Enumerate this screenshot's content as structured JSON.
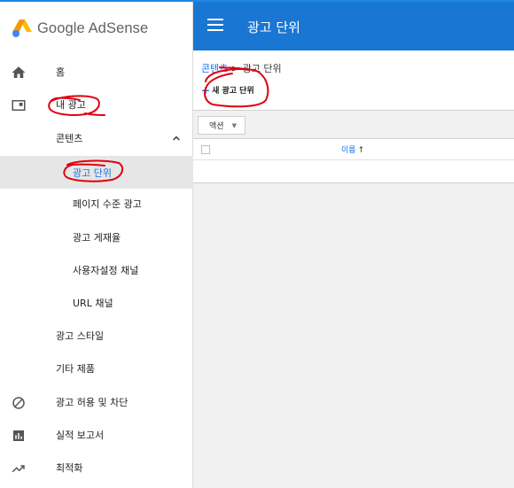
{
  "app": {
    "logo_text": "Google AdSense"
  },
  "sidebar": {
    "items": [
      {
        "label": "홈",
        "icon": "home-icon"
      },
      {
        "label": "내 광고",
        "icon": "ad-unit-icon"
      },
      {
        "label": "콘텐츠",
        "expanded": true
      },
      {
        "label": "광고 단위",
        "active": true
      },
      {
        "label": "페이지 수준 광고"
      },
      {
        "label": "광고 게재율"
      },
      {
        "label": "사용자설정 채널"
      },
      {
        "label": "URL 채널"
      },
      {
        "label": "광고 스타일"
      },
      {
        "label": "기타 제품"
      },
      {
        "label": "광고 허용 및 차단",
        "icon": "block-icon"
      },
      {
        "label": "실적 보고서",
        "icon": "bar-chart-icon"
      },
      {
        "label": "최적화",
        "icon": "trending-up-icon"
      }
    ]
  },
  "header": {
    "title": "광고 단위"
  },
  "main": {
    "breadcrumb": {
      "link": "콘텐츠",
      "separator": " > ",
      "current": "광고 단위"
    },
    "new_button": {
      "plus": "+",
      "label": "새 광고 단위"
    },
    "toolbar": {
      "action_label": "액션",
      "caret": "▼"
    },
    "table": {
      "column_name": "이름",
      "sort_arrow": "↑"
    }
  },
  "colors": {
    "header_blue": "#1976d2",
    "link_blue": "#1a73e8",
    "annotation_red": "#e0000f"
  }
}
